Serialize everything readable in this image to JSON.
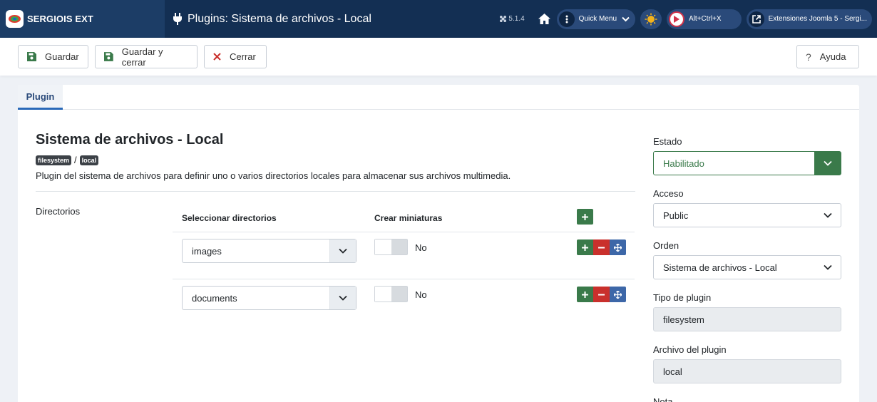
{
  "header": {
    "brand": "SERGIOIS EXT",
    "page_title": "Plugins: Sistema de archivos - Local",
    "version": "5.1.4",
    "quick_menu": "Quick Menu",
    "shortcut": "Alt+Ctrl+X",
    "site_link": "Extensiones Joomla 5 - Sergi..."
  },
  "toolbar": {
    "save": "Guardar",
    "save_close": "Guardar y cerrar",
    "close": "Cerrar",
    "help": "Ayuda"
  },
  "tabs": [
    {
      "label": "Plugin",
      "active": true
    }
  ],
  "plugin": {
    "title": "Sistema de archivos - Local",
    "badge_group": "filesystem",
    "badge_separator": "/",
    "badge_element": "local",
    "description": "Plugin del sistema de archivos para definir uno o varios directorios locales para almacenar sus archivos multimedia."
  },
  "directories": {
    "label": "Directorios",
    "col_select": "Seleccionar directorios",
    "col_thumbs": "Crear miniaturas",
    "rows": [
      {
        "directory": "images",
        "thumbs": "No"
      },
      {
        "directory": "documents",
        "thumbs": "No"
      }
    ]
  },
  "sidebar": {
    "estado_label": "Estado",
    "estado_value": "Habilitado",
    "acceso_label": "Acceso",
    "acceso_value": "Public",
    "orden_label": "Orden",
    "orden_value": "Sistema de archivos - Local",
    "tipo_label": "Tipo de plugin",
    "tipo_value": "filesystem",
    "archivo_label": "Archivo del plugin",
    "archivo_value": "local",
    "nota_label": "Nota"
  },
  "colors": {
    "header_bg": "#132f53",
    "success": "#3a7a4a",
    "danger": "#c9302c",
    "primary": "#3d67a8"
  }
}
